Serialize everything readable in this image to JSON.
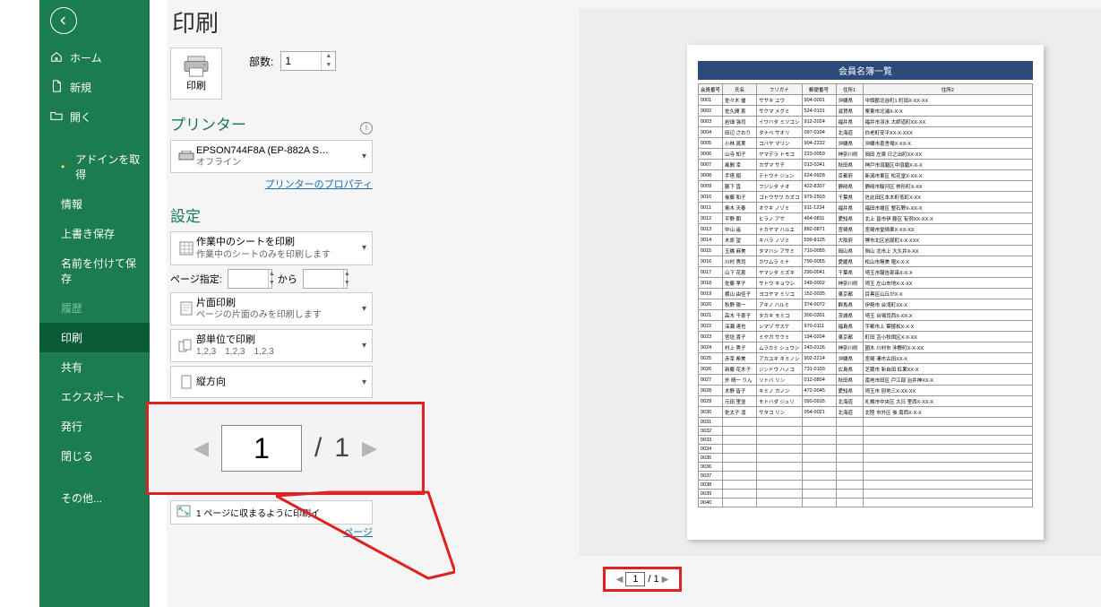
{
  "title": "印刷",
  "sidebar": {
    "items": [
      {
        "label": "ホーム",
        "icon": "home"
      },
      {
        "label": "新規",
        "icon": "file"
      },
      {
        "label": "開く",
        "icon": "open"
      },
      {
        "label": "アドインを取得",
        "bullet": true
      },
      {
        "label": "情報"
      },
      {
        "label": "上書き保存"
      },
      {
        "label": "名前を付けて保存"
      },
      {
        "label": "履歴",
        "dim": true
      },
      {
        "label": "印刷",
        "active": true
      },
      {
        "label": "共有"
      },
      {
        "label": "エクスポート"
      },
      {
        "label": "発行"
      },
      {
        "label": "閉じる"
      },
      {
        "label": "その他..."
      }
    ]
  },
  "print": {
    "button_label": "印刷",
    "copies_label": "部数:",
    "copies_value": "1"
  },
  "printer": {
    "heading": "プリンター",
    "name": "EPSON744F8A (EP-882A S…",
    "status": "オフライン",
    "properties_link": "プリンターのプロパティ"
  },
  "settings": {
    "heading": "設定",
    "scope": {
      "t1": "作業中のシートを印刷",
      "t2": "作業中のシートのみを印刷します"
    },
    "page_range": {
      "label": "ページ指定:",
      "from": "",
      "to": "",
      "kara": "から"
    },
    "sides": {
      "t1": "片面印刷",
      "t2": "ページの片面のみを印刷します"
    },
    "collate": {
      "t1": "部単位で印刷",
      "t2": "1,2,3　1,2,3　1,2,3"
    },
    "orient": {
      "t1": "縦方向"
    },
    "fit": {
      "t2": "1 ページに収まるように印刷イ"
    },
    "page_setup_link": "ページ"
  },
  "nav": {
    "current": "1",
    "total": "1"
  },
  "callout": {
    "current": "1",
    "slash": "/",
    "total": "1"
  },
  "preview": {
    "title": "会員名簿一覧",
    "headers": [
      "会員番号",
      "氏名",
      "フリガナ",
      "郵便番号",
      "住所1",
      "住所2"
    ],
    "rows": [
      [
        "0001",
        "佐々木 優",
        "ササキ ユウ",
        "904-0001",
        "沖縄県",
        "中頭郡北谷町1 町田X-XX-XX"
      ],
      [
        "0002",
        "佐久間 恵",
        "サクマ メグミ",
        "524-0101",
        "滋賀県",
        "栗東市北浦X-X-X"
      ],
      [
        "0003",
        "岩畑 強司",
        "イワハタ ミツコシ",
        "912-2024",
        "福井県",
        "福井市羽水 大師道町XX-XX"
      ],
      [
        "0004",
        "田辺 さおり",
        "タナベ サオリ",
        "097-0104",
        "北海道",
        "白老町安平XX-X-XXX"
      ],
      [
        "0005",
        "小林 真実",
        "コバヤ マリン",
        "904-2232",
        "沖縄県",
        "沖縄市喜舎場X-XX-X"
      ],
      [
        "0006",
        "山寺 知子",
        "ヤマデラ トモコ",
        "223-0059",
        "神奈川県",
        "岡田 左泉 日之出町XX-XX"
      ],
      [
        "0007",
        "風間 幸",
        "カザマ サチ",
        "013-0341",
        "秋田県",
        "神戸市須磨区中須磨X-X-X"
      ],
      [
        "0008",
        "手塔 順",
        "テトウナ ジュン",
        "624-0928",
        "京都府",
        "新潟市東区 松花堂X-XX-X"
      ],
      [
        "0009",
        "藤下 直",
        "フジシタ ナオ",
        "422-8307",
        "静岡県",
        "静岡市駿河区 桝形町X-XX"
      ],
      [
        "0010",
        "後藤 和子",
        "ゴトウサワ カズコ",
        "979-2503",
        "千葉県",
        "佐此田区本木町低町X-XX"
      ],
      [
        "0011",
        "奥木 天泰",
        "オクキ ノゾミ",
        "911-1234",
        "福井県",
        "福田市檜区 整石野X-XX-X"
      ],
      [
        "0012",
        "平野 朝",
        "ヒラノ アサ",
        "464-0811",
        "愛知県",
        "北上 皆市伊 藤区 有例XX-XX-X"
      ],
      [
        "0013",
        "中山 遥",
        "ナカヤマ ハルエ",
        "882-0871",
        "宮崎県",
        "宮崎市堂崎車X-XX-XX"
      ],
      [
        "0014",
        "木原 望",
        "キハラ ノゾミ",
        "599-8125",
        "大阪府",
        "堺市北区岩尾町X-X-XXX"
      ],
      [
        "0015",
        "玉橋 麻美",
        "タマハシ アサミ",
        "710-0055",
        "岡山県",
        "岡山 北市上 大久井X-XX"
      ],
      [
        "0016",
        "川村 秀司",
        "カワムラ ミナ",
        "790-0055",
        "愛媛県",
        "松山市無美 壇X-X-X"
      ],
      [
        "0017",
        "山下 花恵",
        "ヤマシタ ミズキ",
        "290-0041",
        "千葉県",
        "埼玉市報告部串X-X-X"
      ],
      [
        "0018",
        "佐藤 孝子",
        "サトウ キョウシ",
        "249-0002",
        "神奈川県",
        "埼玉 左山市地X-X-XX"
      ],
      [
        "0019",
        "横山 由佳子",
        "ヨコヤマ ミリコ",
        "152-0035",
        "東京都",
        "目黒区山丘がX-X"
      ],
      [
        "0020",
        "秋野 陽一",
        "アキノ ハルミ",
        "374-0072",
        "群馬県",
        "伊勢市 台湾町XX-X"
      ],
      [
        "0021",
        "高木 千恵子",
        "タカキ モミコ",
        "300-0301",
        "茨城県",
        "埼玉 台場司西X-XX-X"
      ],
      [
        "0022",
        "深瀬 達也",
        "シマゾ サスケ",
        "970-0111",
        "福島県",
        "宇都市上 葉稜松X-X-X"
      ],
      [
        "0023",
        "宮垣 喜子",
        "ミヤガ サクミ",
        "194-0204",
        "東京都",
        "町田 苫小牧宿区X-X-XX"
      ],
      [
        "0024",
        "村上 秀子",
        "ムラカミ シュウシ",
        "243-0126",
        "神奈川県",
        "國木 川村市 沖野町X-X-XX"
      ],
      [
        "0025",
        "赤幸 希美",
        "アカユキ キミノシ",
        "902-2214",
        "沖縄県",
        "宮崎 澤市古田XX-X"
      ],
      [
        "0026",
        "新藤 花木子",
        "ジンドウ ハノコ",
        "731-0103",
        "広島県",
        "芝蔵市 新自田 紅果XX-X"
      ],
      [
        "0027",
        "外 晴一 りん",
        "ソトバ リン",
        "012-0804",
        "秋田県",
        "南地市田区 戸江部 治井神XX-X"
      ],
      [
        "0028",
        "木野 皆子",
        "キミノ カノン",
        "472-0045",
        "愛知県",
        "埼玉市 別地三X-XX-XX"
      ],
      [
        "0029",
        "元田 里並",
        "モトハダ ジュリ",
        "090-0915",
        "北海道",
        "札幌市中央区 大日 里西X-XX-X"
      ],
      [
        "0030",
        "佐太子 凛",
        "サタコ リン",
        "054-0021",
        "北海道",
        "北陸 市外区 後 南西X-X-X"
      ],
      [
        "0031",
        "",
        "",
        "",
        "",
        ""
      ],
      [
        "0032",
        "",
        "",
        "",
        "",
        ""
      ],
      [
        "0033",
        "",
        "",
        "",
        "",
        ""
      ],
      [
        "0034",
        "",
        "",
        "",
        "",
        ""
      ],
      [
        "0035",
        "",
        "",
        "",
        "",
        ""
      ],
      [
        "0036",
        "",
        "",
        "",
        "",
        ""
      ],
      [
        "0037",
        "",
        "",
        "",
        "",
        ""
      ],
      [
        "0038",
        "",
        "",
        "",
        "",
        ""
      ],
      [
        "0039",
        "",
        "",
        "",
        "",
        ""
      ],
      [
        "0040",
        "",
        "",
        "",
        "",
        ""
      ]
    ]
  }
}
